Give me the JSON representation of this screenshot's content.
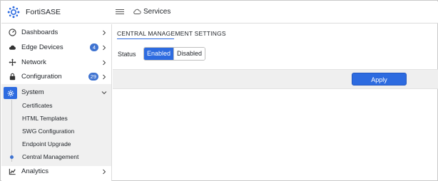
{
  "app": {
    "name": "FortiSASE"
  },
  "header": {
    "breadcrumb": "Services"
  },
  "sidebar": {
    "items": [
      {
        "label": "Dashboards",
        "icon": "gauge-icon"
      },
      {
        "label": "Edge Devices",
        "icon": "cloud-icon",
        "badge": "4"
      },
      {
        "label": "Network",
        "icon": "network-arrows-icon"
      },
      {
        "label": "Configuration",
        "icon": "lock-icon",
        "badge": "29"
      },
      {
        "label": "System",
        "icon": "gear-icon",
        "expanded": true
      },
      {
        "label": "Analytics",
        "icon": "analytics-icon"
      }
    ],
    "system_sub": [
      {
        "label": "Certificates"
      },
      {
        "label": "HTML Templates"
      },
      {
        "label": "SWG Configuration"
      },
      {
        "label": "Endpoint Upgrade"
      },
      {
        "label": "Central Management",
        "active": true
      }
    ]
  },
  "main": {
    "section_title": "CENTRAL MANAGEMENT SETTINGS",
    "status_label": "Status",
    "status_options": [
      "Enabled",
      "Disabled"
    ],
    "status_selected": "Enabled",
    "apply_label": "Apply"
  },
  "colors": {
    "accent": "#2d6be0",
    "badge": "#3f73d1",
    "system_highlight": "#f0f0f0"
  }
}
